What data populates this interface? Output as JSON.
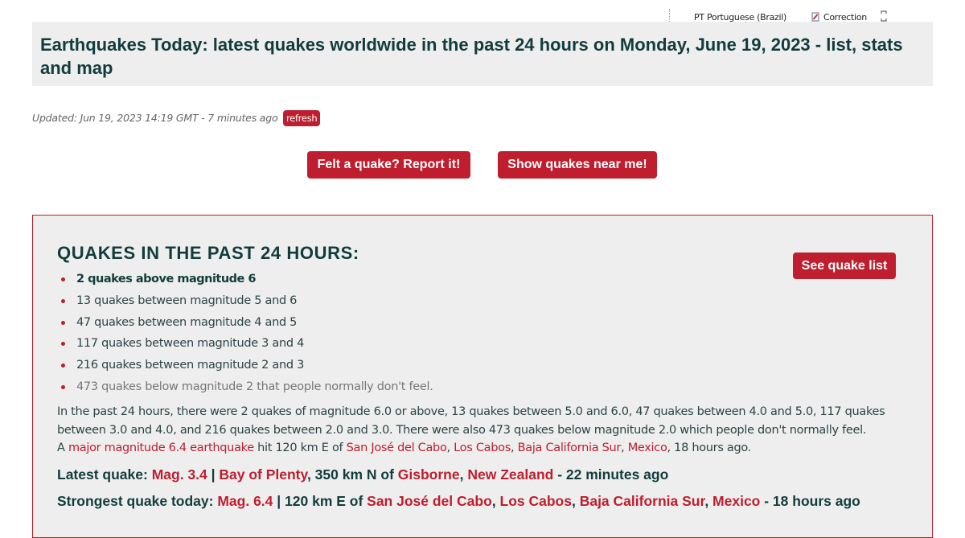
{
  "toolbar": {
    "language": "PT Portuguese (Brazil)",
    "correction": "Correction"
  },
  "header": {
    "title": "Earthquakes Today: latest quakes worldwide in the past 24 hours on Monday, June 19, 2023 - list, stats and map"
  },
  "updated": {
    "text": "Updated: Jun 19, 2023 14:19 GMT - 7 minutes ago",
    "refresh_label": "refresh"
  },
  "actions": {
    "report_label": "Felt a quake? Report it!",
    "near_label": "Show quakes near me!"
  },
  "stats": {
    "heading": "QUAKES IN THE PAST 24 HOURS:",
    "see_list_label": "See quake list",
    "items": [
      "2 quakes above magnitude 6",
      "13 quakes between magnitude 5 and 6",
      "47 quakes between magnitude 4 and 5",
      "117 quakes between magnitude 3 and 4",
      "216 quakes between magnitude 2 and 3",
      "473 quakes below magnitude 2 that people normally don't feel."
    ],
    "summary": "In the past 24 hours, there were 2 quakes of magnitude 6.0 or above, 13 quakes between 5.0 and 6.0, 47 quakes between 4.0 and 5.0, 117 quakes between 3.0 and 4.0, and 216 quakes between 2.0 and 3.0. There were also 473 quakes below magnitude 2.0 which people don't normally feel.",
    "major": {
      "prefix": "A ",
      "link": "major magnitude 6.4 earthquake",
      "mid": " hit 120 km E of ",
      "city": "San José del Cabo",
      "comma1": ", ",
      "municipality": "Los Cabos",
      "comma2": ", ",
      "state": "Baja California Sur",
      "comma3": ", ",
      "country": "Mexico",
      "suffix": ", 18 hours ago."
    }
  },
  "latest": {
    "label": "Latest quake: ",
    "mag": "Mag. 3.4",
    "sep": " | ",
    "place": "Bay of Plenty",
    "mid": ", 350 km N of ",
    "city": "Gisborne",
    "comma": ", ",
    "country": "New Zealand",
    "suffix": " - 22 minutes ago"
  },
  "strongest": {
    "label": "Strongest quake today: ",
    "mag": "Mag. 6.4",
    "mid": " | 120 km E of ",
    "city": "San José del Cabo",
    "comma1": ", ",
    "municipality": "Los Cabos",
    "comma2": ", ",
    "state": "Baja California Sur",
    "comma3": ", ",
    "country": "Mexico",
    "suffix": " - 18 hours ago"
  }
}
